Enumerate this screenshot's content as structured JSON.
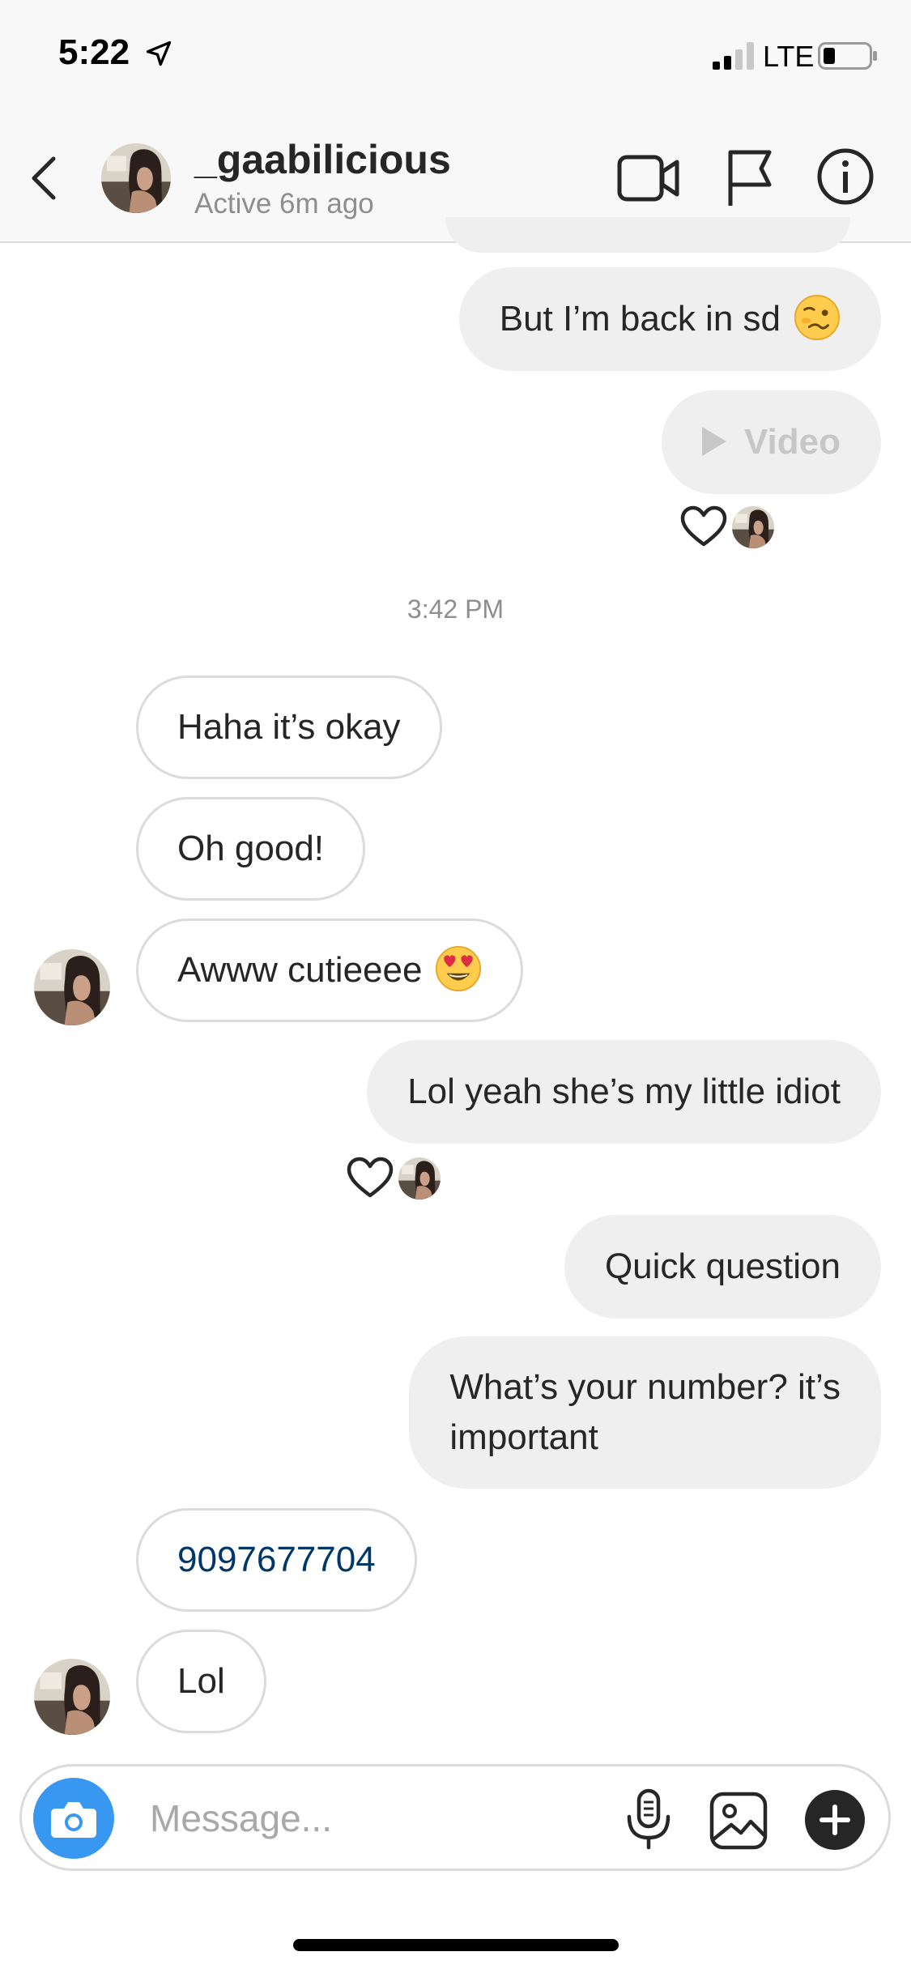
{
  "status_bar": {
    "time": "5:22",
    "network": "LTE"
  },
  "header": {
    "username": "_gaabilicious",
    "active_status": "Active 6m ago"
  },
  "messages": [
    {
      "sender": "me",
      "text": "But I’m back in sd",
      "emoji": "woozy-face"
    },
    {
      "sender": "me",
      "type": "video",
      "text": "Video",
      "liked": true
    },
    {
      "type": "timestamp",
      "text": "3:42 PM"
    },
    {
      "sender": "them",
      "text": "Haha it’s okay"
    },
    {
      "sender": "them",
      "text": "Oh good!"
    },
    {
      "sender": "them",
      "text": "Awww cutieeee",
      "emoji": "heart-eyes"
    },
    {
      "sender": "me",
      "text": "Lol yeah she’s my little idiot",
      "liked": true
    },
    {
      "sender": "me",
      "text": "Quick question"
    },
    {
      "sender": "me",
      "lines": [
        "What’s your number? it’s",
        "important"
      ]
    },
    {
      "sender": "them",
      "text": "9097677704",
      "link": true
    },
    {
      "sender": "them",
      "text": "Lol"
    }
  ],
  "composer": {
    "placeholder": "Message..."
  },
  "colors": {
    "sent_bubble": "#efefef",
    "received_border": "#dbdbdb",
    "camera_button": "#3897f0",
    "link_text": "#00376b",
    "muted": "#8e8e8e"
  },
  "icons": [
    "back-chevron-icon",
    "video-camera-icon",
    "flag-icon",
    "info-icon",
    "heart-icon",
    "camera-icon",
    "microphone-icon",
    "gallery-icon",
    "plus-icon"
  ]
}
